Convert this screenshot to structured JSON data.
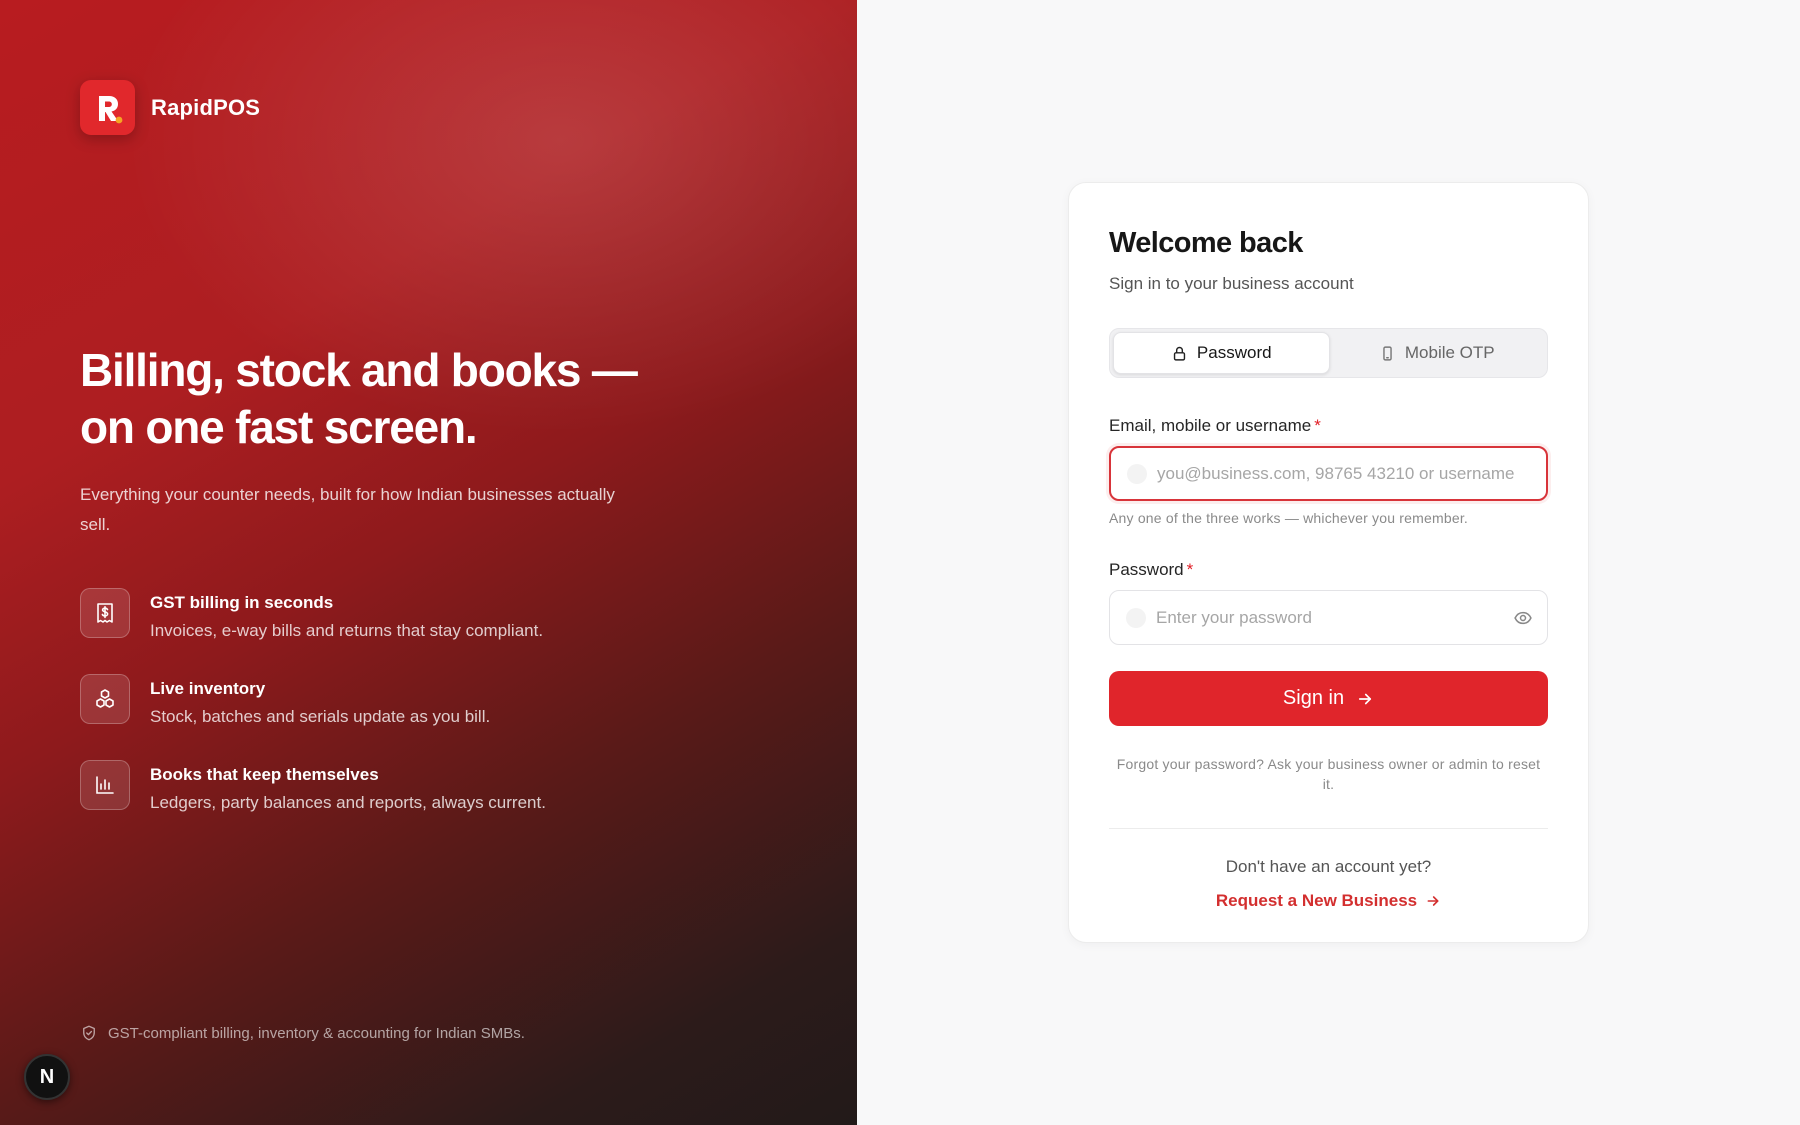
{
  "brand": {
    "name": "RapidPOS",
    "logo_letter": "R"
  },
  "hero": {
    "title_line1": "Billing, stock and books —",
    "title_line2": "on one fast screen.",
    "subtitle": "Everything your counter needs, built for how Indian businesses actually sell."
  },
  "features": [
    {
      "icon": "receipt-icon",
      "title": "GST billing in seconds",
      "desc": "Invoices, e-way bills and returns that stay compliant."
    },
    {
      "icon": "boxes-icon",
      "title": "Live inventory",
      "desc": "Stock, batches and serials update as you bill."
    },
    {
      "icon": "bar-chart-icon",
      "title": "Books that keep themselves",
      "desc": "Ledgers, party balances and reports, always current."
    }
  ],
  "footer_note": "GST-compliant billing, inventory & accounting for Indian SMBs.",
  "dev_badge": "N",
  "card": {
    "title": "Welcome back",
    "subtitle": "Sign in to your business account",
    "tabs": [
      {
        "label": "Password",
        "icon": "lock-icon",
        "active": true
      },
      {
        "label": "Mobile OTP",
        "icon": "phone-icon",
        "active": false
      }
    ],
    "identifier": {
      "label": "Email, mobile or username",
      "required_mark": "*",
      "placeholder": "you@business.com, 98765 43210 or username",
      "value": "",
      "hint": "Any one of the three works — whichever you remember."
    },
    "password": {
      "label": "Password",
      "required_mark": "*",
      "placeholder": "Enter your password",
      "value": ""
    },
    "signin_label": "Sign in",
    "forgot_text": "Forgot your password? Ask your business owner or admin to reset it.",
    "no_account_text": "Don't have an account yet?",
    "request_label": "Request a New Business"
  },
  "colors": {
    "accent": "#e0252b",
    "link": "#d32f2f",
    "left_panel_start": "#b81c20",
    "left_panel_end": "#221a19"
  }
}
